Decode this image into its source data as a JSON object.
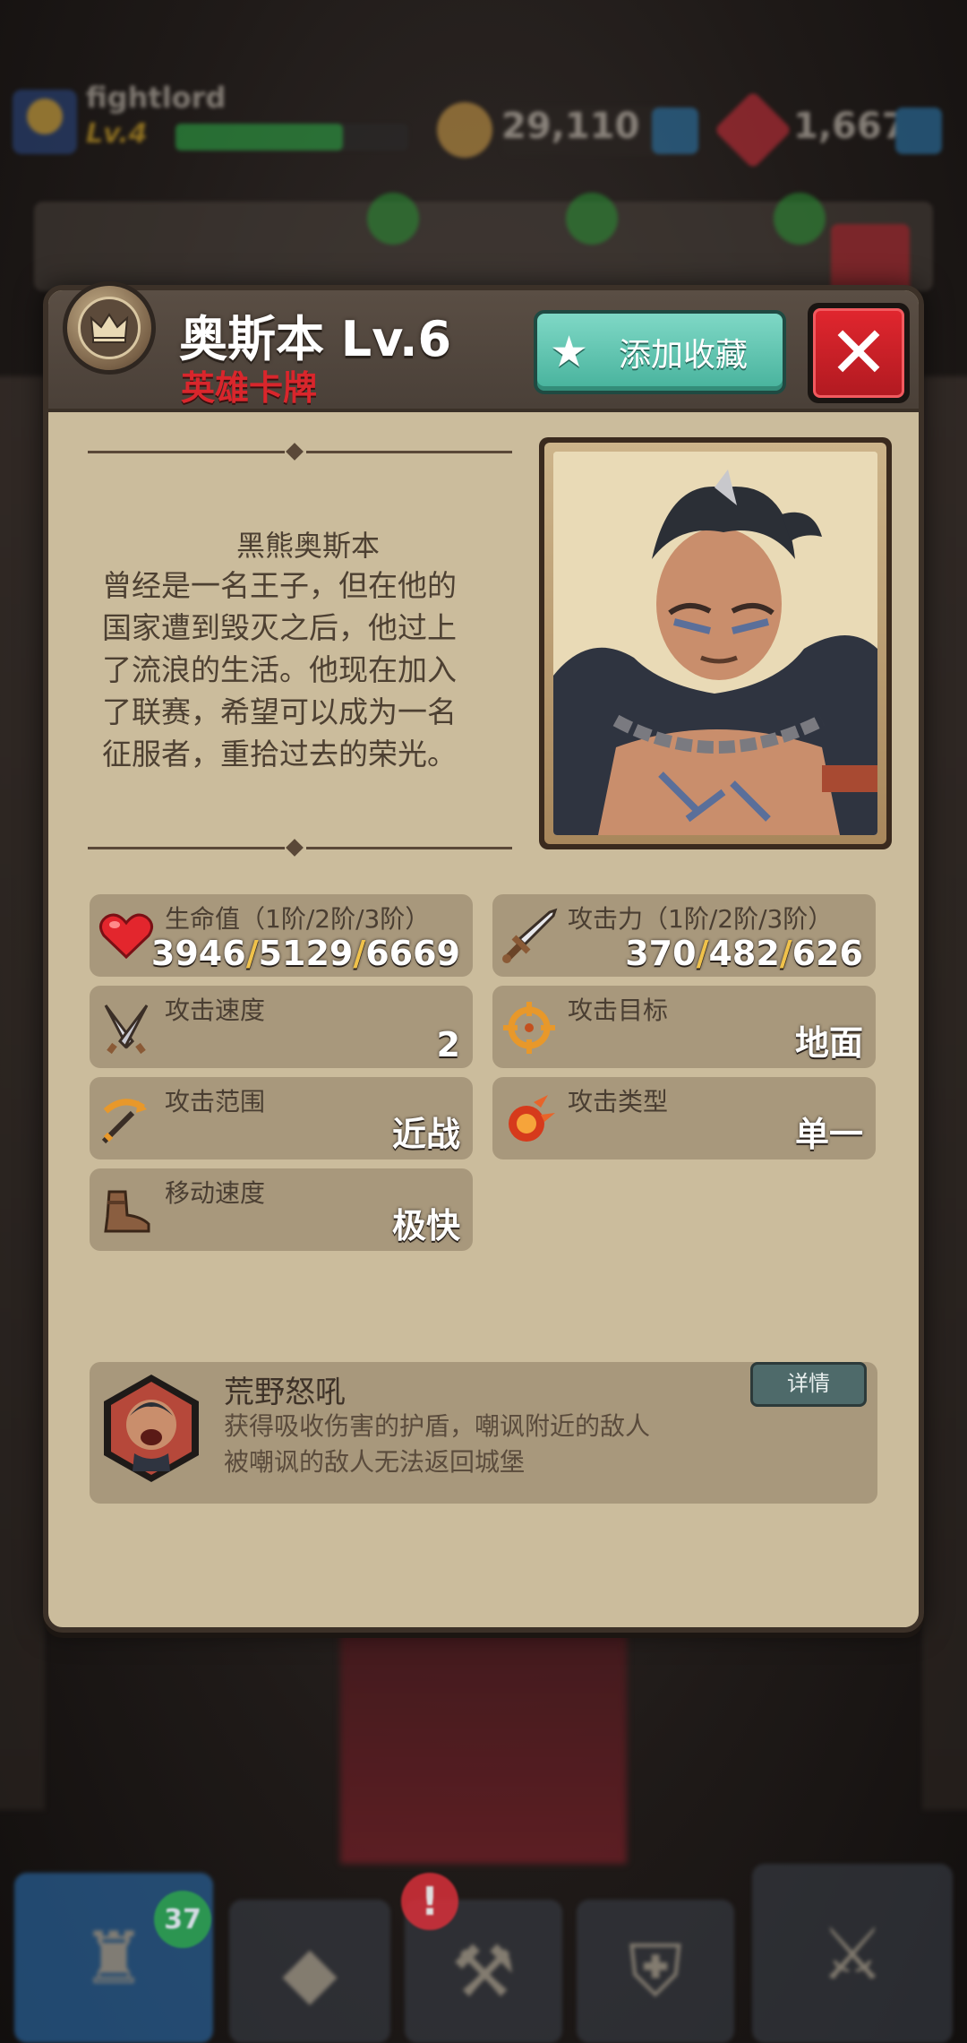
{
  "background_hud": {
    "player_name": "fightlord",
    "level": "Lv.4",
    "xp_fraction": 0.72,
    "gold": "29,110",
    "gems": "1,667"
  },
  "bottom_nav": {
    "badge_count": "37",
    "alert": "!"
  },
  "hero": {
    "name_level": "奥斯本 Lv.6",
    "card_type": "英雄卡牌",
    "favorite_label": "添加收藏",
    "close_label": "✕",
    "lore_title": "黑熊奥斯本",
    "lore_lines": [
      "曾经是一名王子，但在他的",
      "国家遭到毁灭之后，他过上",
      "了流浪的生活。他现在加入",
      "了联赛，希望可以成为一名",
      "征服者，重拾过去的荣光。"
    ]
  },
  "stats": {
    "hp": {
      "label": "生命值（1阶/2阶/3阶）",
      "v1": "3946",
      "v2": "5129",
      "v3": "6669",
      "sep": "/"
    },
    "atk": {
      "label": "攻击力（1阶/2阶/3阶）",
      "v1": "370",
      "v2": "482",
      "v3": "626",
      "sep": "/"
    },
    "atk_speed": {
      "label": "攻击速度",
      "value": "2"
    },
    "atk_target": {
      "label": "攻击目标",
      "value": "地面"
    },
    "atk_range": {
      "label": "攻击范围",
      "value": "近战"
    },
    "atk_type": {
      "label": "攻击类型",
      "value": "单一"
    },
    "move_speed": {
      "label": "移动速度",
      "value": "极快"
    }
  },
  "skill": {
    "name": "荒野怒吼",
    "desc_line1": "获得吸收伤害的护盾，嘲讽附近的敌人",
    "desc_line2": "被嘲讽的敌人无法返回城堡",
    "detail_label": "详情"
  },
  "colors": {
    "panel": "#cbbc9c",
    "stat_box": "#a8987c",
    "title_red": "#d9262c",
    "fav_teal": "#47b29c",
    "close_red": "#d11f27"
  }
}
